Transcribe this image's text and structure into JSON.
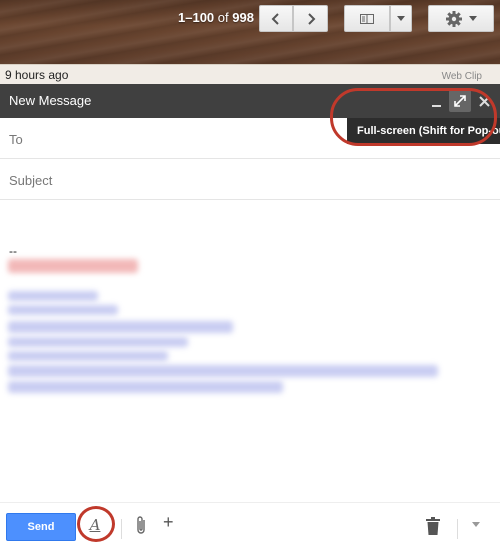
{
  "toolbar": {
    "pager_range": "1–100",
    "pager_of": "of",
    "pager_total": "998",
    "prev_icon": "chevron-left-icon",
    "next_icon": "chevron-right-icon",
    "view_icon": "split-pane-icon",
    "settings_icon": "gear-icon"
  },
  "mail_strip": {
    "time": "9 hours ago",
    "web_clip": "Web Clip"
  },
  "compose": {
    "title": "New Message",
    "tooltip": "Full-screen (Shift for Pop-out)",
    "to_label": "To",
    "subject_placeholder": "Subject",
    "signature_dash": "--",
    "send_label": "Send"
  },
  "colors": {
    "header_bg": "#404040",
    "send_blue": "#4d90fe",
    "highlight_red": "#c0392b"
  }
}
